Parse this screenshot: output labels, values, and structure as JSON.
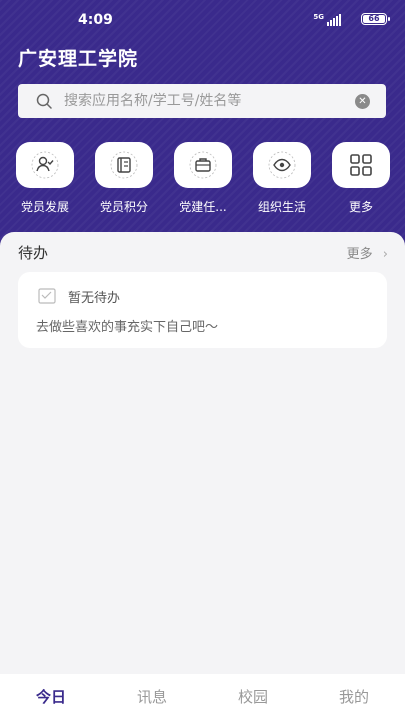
{
  "status_bar": {
    "time": "4:09",
    "network": "5G",
    "battery": "66"
  },
  "header": {
    "title": "广安理工学院"
  },
  "search": {
    "placeholder": "搜索应用名称/学工号/姓名等"
  },
  "shortcuts": [
    {
      "label": "党员发展",
      "icon": "person-check-icon"
    },
    {
      "label": "党员积分",
      "icon": "notebook-icon"
    },
    {
      "label": "党建任...",
      "icon": "briefcase-icon"
    },
    {
      "label": "组织生活",
      "icon": "eye-icon"
    },
    {
      "label": "更多",
      "icon": "grid-icon"
    }
  ],
  "todo": {
    "title": "待办",
    "more": "更多",
    "empty_title": "暂无待办",
    "empty_hint": "去做些喜欢的事充实下自己吧～"
  },
  "tabs": [
    {
      "label": "今日",
      "active": true
    },
    {
      "label": "讯息",
      "active": false
    },
    {
      "label": "校园",
      "active": false
    },
    {
      "label": "我的",
      "active": false
    }
  ],
  "colors": {
    "primary": "#3a2a8c",
    "background": "#f4f4f6"
  }
}
